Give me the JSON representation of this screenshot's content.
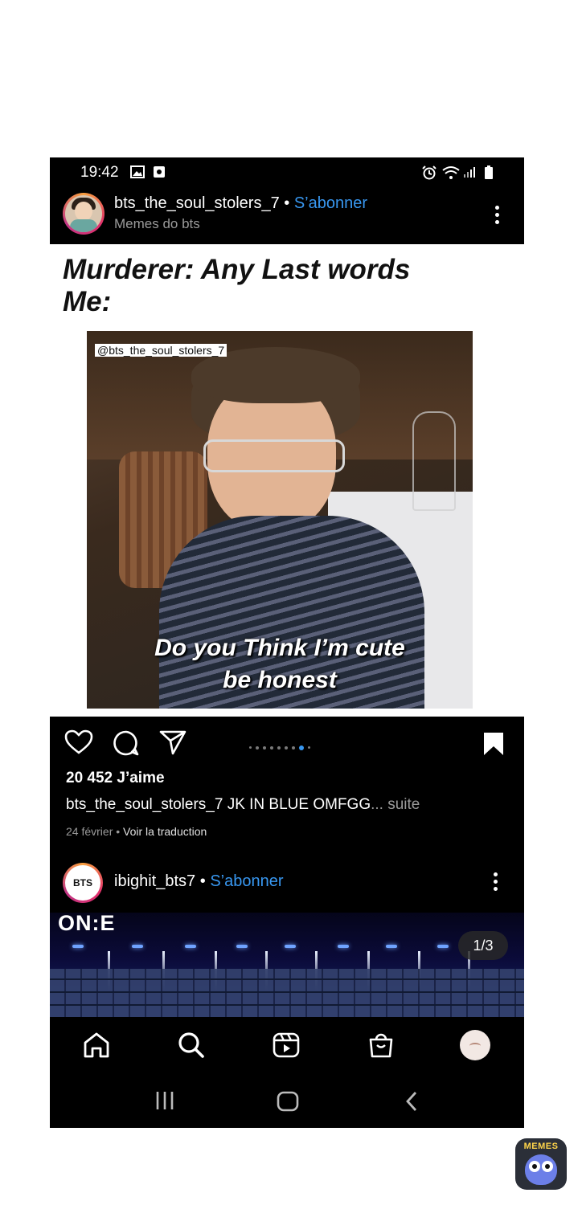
{
  "status": {
    "time": "19:42"
  },
  "post1": {
    "username": "bts_the_soul_stolers_7",
    "separator": " • ",
    "follow": "S’abonner",
    "subtitle": "Memes do bts"
  },
  "meme": {
    "line1": "Murderer: Any Last words",
    "line2": "Me:",
    "watermark": "@bts_the_soul_stolers_7",
    "caption1": "Do you Think I’m cute",
    "caption2": "be honest"
  },
  "post1_footer": {
    "likes": "20 452 J’aime",
    "caption_user": "bts_the_soul_stolers_7",
    "caption_text": " JK IN BLUE OMFGG",
    "more": "... suite",
    "date": "24 février",
    "date_sep": " • ",
    "translate": "Voir la traduction",
    "carousel_total": 9,
    "carousel_active": 8
  },
  "post2": {
    "logo": "BTS",
    "username": "ibighit_bts7",
    "separator": " • ",
    "follow": "S’abonner",
    "media_brand": "ON:E",
    "counter": "1/3"
  },
  "tabs": [
    "home-icon",
    "search-icon",
    "reels-icon",
    "shop-icon",
    "profile-avatar"
  ],
  "nav": [
    "recent-apps-icon",
    "home-button-icon",
    "back-icon"
  ],
  "badge": {
    "label": "MEMES"
  },
  "colors": {
    "link": "#3897f0",
    "bg": "#000000",
    "muted": "#9a9a9a"
  }
}
